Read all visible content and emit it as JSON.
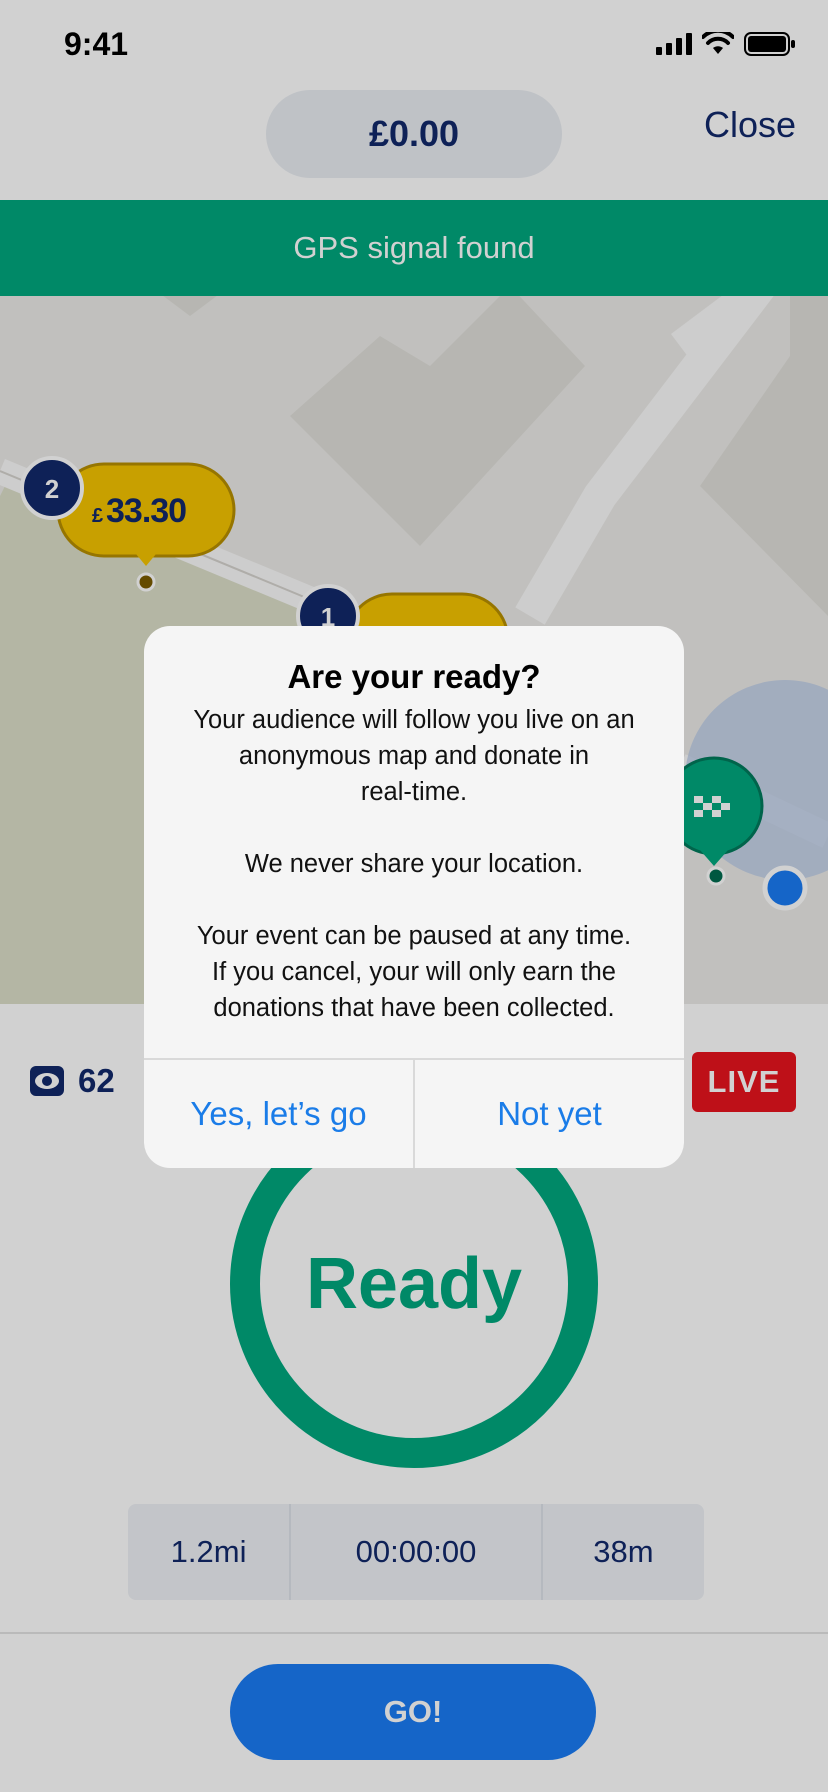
{
  "status_bar": {
    "time": "9:41"
  },
  "header": {
    "amount": "£0.00",
    "close_label": "Close"
  },
  "gps_banner": {
    "text": "GPS signal found"
  },
  "map": {
    "marker_2": {
      "number": "2",
      "currency": "£",
      "amount": "33.30"
    },
    "marker_1": {
      "number": "1"
    },
    "finish_flag_icon": "checkered-flag-icon",
    "location_icon": "current-location-dot-icon"
  },
  "stats_panel": {
    "viewers_icon": "eye-icon",
    "viewers_count": "62",
    "live_label": "LIVE",
    "status_label": "Ready",
    "distance": "1.2mi",
    "elapsed": "00:00:00",
    "elevation": "38m"
  },
  "footer": {
    "go_label": "GO!"
  },
  "alert": {
    "title": "Are your ready?",
    "lines": [
      "Your audience will follow you live on an",
      "anonymous map and donate in",
      "real-time.",
      "",
      "We never share your location.",
      "",
      "Your event can be paused at any time.",
      "If you cancel, your will only earn the",
      "donations that have been collected."
    ],
    "confirm_label": "Yes, let’s go",
    "cancel_label": "Not yet"
  },
  "colors": {
    "brand_navy": "#12296b",
    "success_green": "#00a87e",
    "live_red": "#e8141e",
    "primary_blue": "#1a7cf5",
    "marker_yellow": "#f5c400"
  }
}
